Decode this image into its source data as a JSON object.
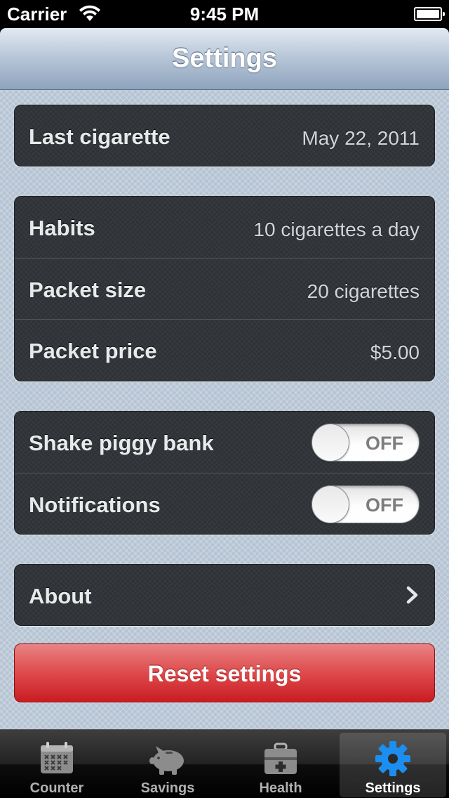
{
  "status_bar": {
    "carrier": "Carrier",
    "time": "9:45 PM",
    "wifi_icon": "wifi-icon",
    "battery_icon": "battery-icon"
  },
  "nav": {
    "title": "Settings"
  },
  "groups": {
    "last_cigarette": {
      "label": "Last cigarette",
      "value": "May 22, 2011"
    },
    "habits": {
      "label": "Habits",
      "value": "10 cigarettes a day"
    },
    "packet_size": {
      "label": "Packet size",
      "value": "20 cigarettes"
    },
    "packet_price": {
      "label": "Packet price",
      "value": "$5.00"
    },
    "shake_piggy_bank": {
      "label": "Shake piggy bank",
      "state": "OFF"
    },
    "notifications": {
      "label": "Notifications",
      "state": "OFF"
    },
    "about": {
      "label": "About",
      "icon": "chevron-right-icon"
    }
  },
  "reset_button": {
    "label": "Reset settings"
  },
  "tabs": [
    {
      "label": "Counter",
      "icon": "calendar-icon"
    },
    {
      "label": "Savings",
      "icon": "piggy-bank-icon"
    },
    {
      "label": "Health",
      "icon": "medical-kit-icon"
    },
    {
      "label": "Settings",
      "icon": "gear-icon"
    }
  ],
  "colors": {
    "accent_tab_icon": "#1c8ef0",
    "reset_red": "#d9393c",
    "nav_blue": "#b9c8d9"
  }
}
